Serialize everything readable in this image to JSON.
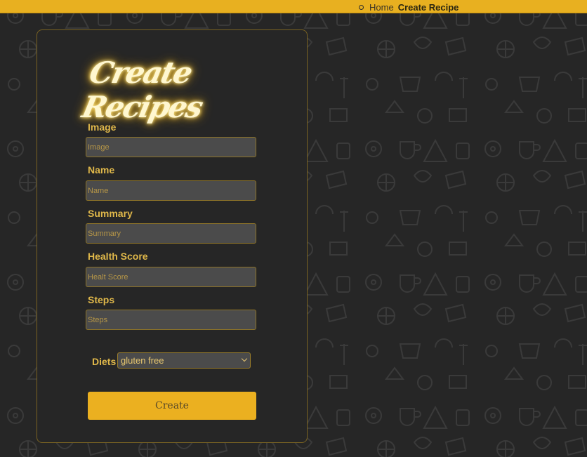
{
  "colors": {
    "accent": "#ebb020",
    "background": "#262626",
    "card_border": "#7a6322",
    "label": "#e0b84a",
    "input_bg": "#4b4b4b"
  },
  "breadcrumb": {
    "icon": "bullet-icon",
    "home": "Home",
    "current": "Create Recipe"
  },
  "form": {
    "title": "Create Recipes",
    "fields": [
      {
        "label": "Image",
        "placeholder": "Image",
        "value": ""
      },
      {
        "label": "Name",
        "placeholder": "Name",
        "value": ""
      },
      {
        "label": "Summary",
        "placeholder": "Summary",
        "value": ""
      },
      {
        "label": "Health Score",
        "placeholder": "Healt Score",
        "value": ""
      },
      {
        "label": "Steps",
        "placeholder": "Steps",
        "value": ""
      }
    ],
    "diets": {
      "label": "Diets",
      "selected": "gluten free",
      "icon": "chevron-down-icon"
    },
    "submit_label": "Create"
  },
  "background_icons": [
    "pizza-icon",
    "ice-cream-icon",
    "coffee-cup-icon",
    "egg-icon",
    "waffle-icon",
    "croissant-icon",
    "cupcake-icon"
  ]
}
